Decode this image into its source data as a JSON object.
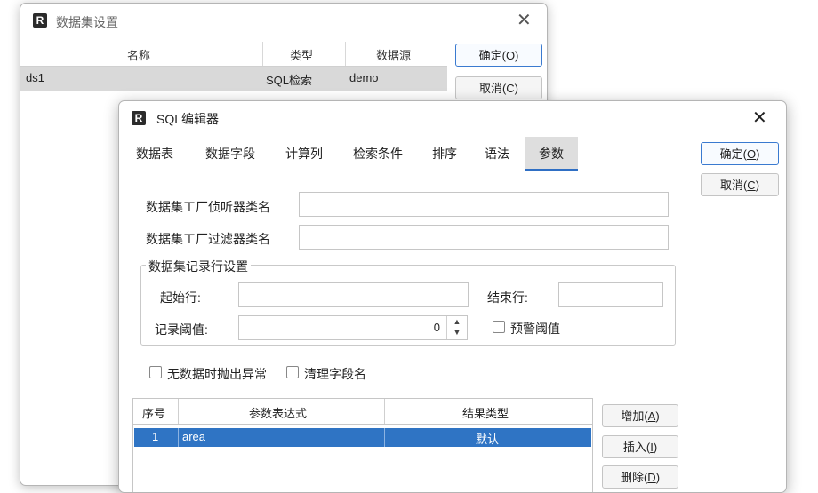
{
  "dataset_dialog": {
    "title": "数据集设置",
    "columns": [
      "名称",
      "类型",
      "数据源"
    ],
    "rows": [
      {
        "name": "ds1",
        "type": "SQL检索",
        "source": "demo"
      }
    ],
    "ok_label": "确定(O)",
    "cancel_label": "取消(C)"
  },
  "sql_editor": {
    "title": "SQL编辑器",
    "tabs": [
      "数据表",
      "数据字段",
      "计算列",
      "检索条件",
      "排序",
      "语法",
      "参数"
    ],
    "active_tab": "参数",
    "ok_label_prefix": "确定(",
    "ok_label_key": "O",
    "ok_label_suffix": ")",
    "cancel_label_prefix": "取消(",
    "cancel_label_key": "C",
    "cancel_label_suffix": ")",
    "listener_label": "数据集工厂侦听器类名",
    "listener_value": "",
    "filter_label": "数据集工厂过滤器类名",
    "filter_value": "",
    "group_title": "数据集记录行设置",
    "start_row_label": "起始行:",
    "start_row_value": "",
    "end_row_label": "结束行:",
    "end_row_value": "",
    "threshold_label": "记录阈值:",
    "threshold_value": "0",
    "warn_threshold_label": "预警阈值",
    "warn_threshold_checked": false,
    "throw_on_empty_label": "无数据时抛出异常",
    "throw_on_empty_checked": false,
    "clean_fields_label": "清理字段名",
    "clean_fields_checked": false,
    "param_columns": [
      "序号",
      "参数表达式",
      "结果类型"
    ],
    "param_rows": [
      {
        "index": "1",
        "expression": "area",
        "result_type": "默认"
      }
    ],
    "add_prefix": "增加(",
    "add_key": "A",
    "add_suffix": ")",
    "insert_prefix": "插入(",
    "insert_key": "I",
    "insert_suffix": ")",
    "delete_prefix": "删除(",
    "delete_key": "D",
    "delete_suffix": ")"
  },
  "colors": {
    "selection": "#2f74c4",
    "active_tab_underline": "#2f6fc4",
    "row_highlight": "#d9d9d9"
  },
  "icons": [
    "app-logo-icon",
    "close-icon",
    "spinner-up-down-icon",
    "checkbox-icon"
  ]
}
